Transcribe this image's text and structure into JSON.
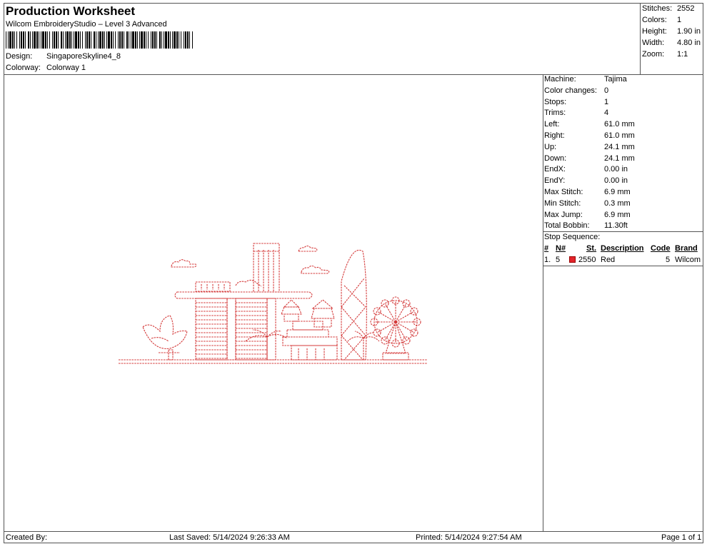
{
  "header": {
    "title": "Production Worksheet",
    "subtitle": "Wilcom EmbroideryStudio – Level 3 Advanced",
    "design_label": "Design:",
    "design_value": "SingaporeSkyline4_8",
    "colorway_label": "Colorway:",
    "colorway_value": "Colorway 1"
  },
  "stats": [
    {
      "label": "Stitches:",
      "value": "2552"
    },
    {
      "label": "Colors:",
      "value": "1"
    },
    {
      "label": "Height:",
      "value": "1.90 in"
    },
    {
      "label": "Width:",
      "value": "4.80 in"
    },
    {
      "label": "Zoom:",
      "value": "1:1"
    }
  ],
  "machine_info": [
    {
      "label": "Machine:",
      "value": "Tajima"
    },
    {
      "label": "Color changes:",
      "value": "0"
    },
    {
      "label": "Stops:",
      "value": "1"
    },
    {
      "label": "Trims:",
      "value": "4"
    },
    {
      "label": "Left:",
      "value": "61.0 mm"
    },
    {
      "label": "Right:",
      "value": "61.0 mm"
    },
    {
      "label": "Up:",
      "value": "24.1 mm"
    },
    {
      "label": "Down:",
      "value": "24.1 mm"
    },
    {
      "label": "EndX:",
      "value": "0.00 in"
    },
    {
      "label": "EndY:",
      "value": "0.00 in"
    },
    {
      "label": "Max Stitch:",
      "value": "6.9 mm"
    },
    {
      "label": "Min Stitch:",
      "value": "0.3 mm"
    },
    {
      "label": "Max Jump:",
      "value": "6.9 mm"
    },
    {
      "label": "Total Bobbin:",
      "value": "11.30ft"
    }
  ],
  "stop_sequence": {
    "title": "Stop Sequence:",
    "headers": {
      "num": "#",
      "n": "N#",
      "st": "St.",
      "description": "Description",
      "code": "Code",
      "brand": "Brand"
    },
    "rows": [
      {
        "num": "1.",
        "n": "5",
        "color": "#e3242b",
        "st": "2550",
        "description": "Red",
        "code": "5",
        "brand": "Wilcom"
      }
    ]
  },
  "footer": {
    "created_by": "Created By:",
    "last_saved": "Last Saved: 5/14/2024 9:26:33 AM",
    "printed": "Printed: 5/14/2024 9:27:54 AM",
    "page": "Page 1 of 1"
  },
  "colors": {
    "thread": "#d43a3a",
    "swatch": "#e3242b"
  }
}
